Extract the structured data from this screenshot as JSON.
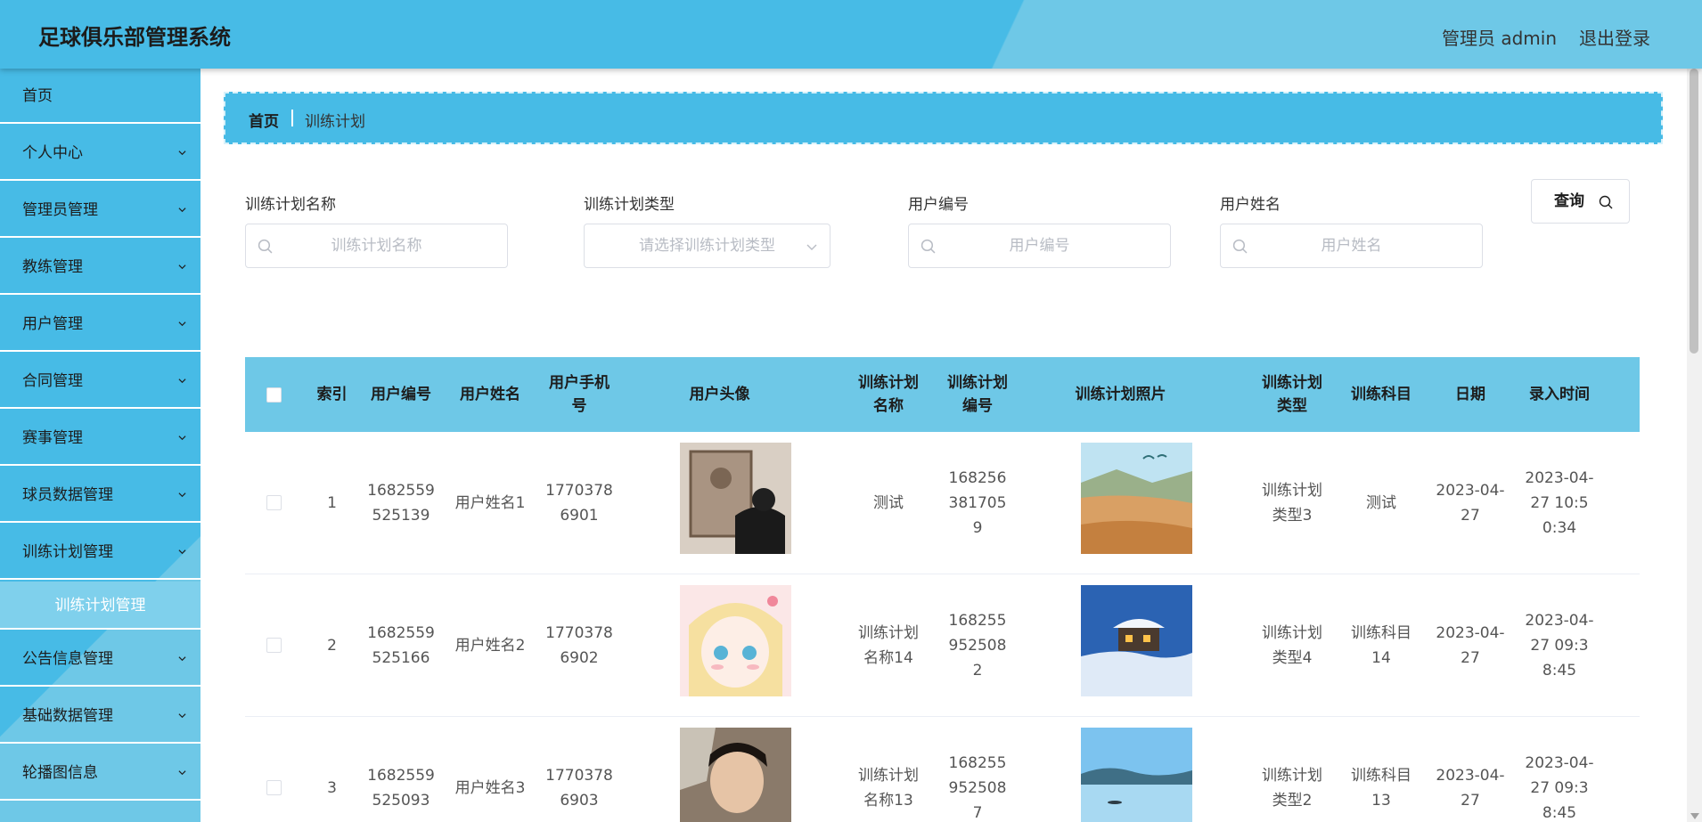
{
  "header": {
    "title": "足球俱乐部管理系统",
    "user": "管理员 admin",
    "logout": "退出登录"
  },
  "sidebar": {
    "items": [
      {
        "label": "首页"
      },
      {
        "label": "个人中心"
      },
      {
        "label": "管理员管理"
      },
      {
        "label": "教练管理"
      },
      {
        "label": "用户管理"
      },
      {
        "label": "合同管理"
      },
      {
        "label": "赛事管理"
      },
      {
        "label": "球员数据管理"
      },
      {
        "label": "训练计划管理"
      },
      {
        "label": "公告信息管理"
      },
      {
        "label": "基础数据管理"
      },
      {
        "label": "轮播图信息"
      }
    ],
    "sub_active": "训练计划管理"
  },
  "breadcrumb": {
    "home": "首页",
    "current": "训练计划"
  },
  "search": {
    "plan_name_label": "训练计划名称",
    "plan_name_placeholder": "训练计划名称",
    "plan_type_label": "训练计划类型",
    "plan_type_placeholder": "请选择训练计划类型",
    "user_no_label": "用户编号",
    "user_no_placeholder": "用户编号",
    "user_name_label": "用户姓名",
    "user_name_placeholder": "用户姓名",
    "button": "查询"
  },
  "table": {
    "columns": [
      "索引",
      "用户编号",
      "用户姓名",
      "用户手机号",
      "用户头像",
      "训练计划名称",
      "训练计划编号",
      "训练计划照片",
      "训练计划类型",
      "训练科目",
      "日期",
      "录入时间"
    ],
    "rows": [
      {
        "index": "1",
        "user_no": "1682559525139",
        "user_name": "用户姓名1",
        "phone": "17703786901",
        "plan_name": "测试",
        "plan_no": "1682563817059",
        "plan_type": "训练计划类型3",
        "subject": "测试",
        "date": "2023-04-27",
        "entered": "2023-04-27 10:50:34"
      },
      {
        "index": "2",
        "user_no": "1682559525166",
        "user_name": "用户姓名2",
        "phone": "17703786902",
        "plan_name": "训练计划名称14",
        "plan_no": "1682559525082",
        "plan_type": "训练计划类型4",
        "subject": "训练科目14",
        "date": "2023-04-27",
        "entered": "2023-04-27 09:38:45"
      },
      {
        "index": "3",
        "user_no": "1682559525093",
        "user_name": "用户姓名3",
        "phone": "17703786903",
        "plan_name": "训练计划名称13",
        "plan_no": "1682559525087",
        "plan_type": "训练计划类型2",
        "subject": "训练科目13",
        "date": "2023-04-27",
        "entered": "2023-04-27 09:38:45"
      }
    ]
  },
  "colors": {
    "primary": "#47bbe6",
    "light": "#6ec8e7",
    "sub": "#7fd0ec"
  },
  "icons": [
    "search-icon",
    "chevron-down-icon"
  ]
}
